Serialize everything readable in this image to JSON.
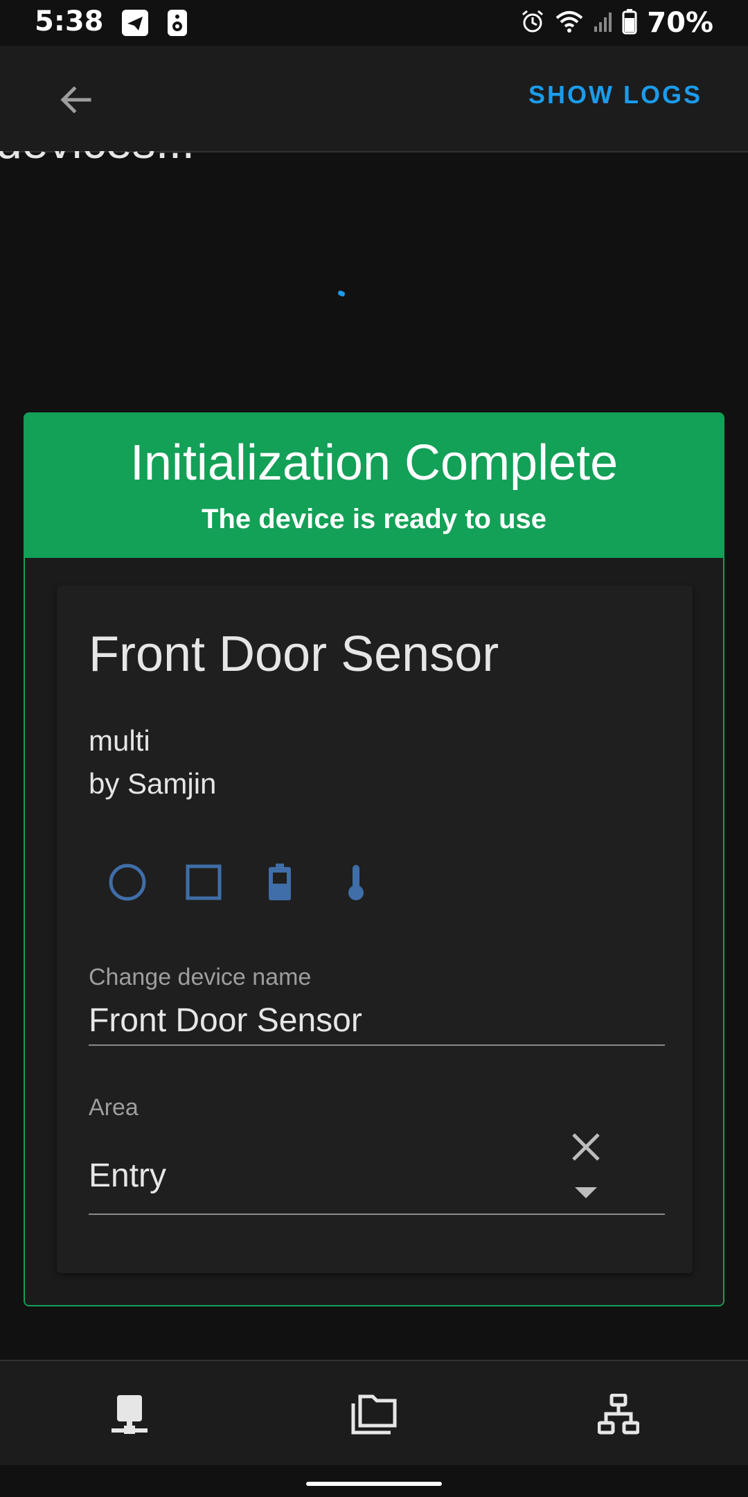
{
  "status_bar": {
    "time": "5:38",
    "battery_percent": "70%",
    "icons": [
      "telegram-icon",
      "speaker-icon",
      "alarm-icon",
      "wifi-icon",
      "cell-signal-icon",
      "battery-icon"
    ]
  },
  "app_bar": {
    "back_icon": "arrow-left-icon",
    "show_logs_label": "SHOW LOGS"
  },
  "background": {
    "heading_partial": "devices..."
  },
  "dialog": {
    "title": "Initialization Complete",
    "subtitle": "The device is ready to use",
    "device": {
      "name": "Front Door Sensor",
      "model": "multi",
      "manufacturer": "by Samjin",
      "entity_icons": [
        "circle-icon",
        "square-icon",
        "battery-icon",
        "thermometer-icon"
      ]
    },
    "name_field": {
      "label": "Change device name",
      "value": "Front Door Sensor"
    },
    "area_field": {
      "label": "Area",
      "value": "Entry"
    }
  },
  "bottom_nav": {
    "items": [
      "devices-icon",
      "folders-icon",
      "network-icon"
    ]
  },
  "colors": {
    "accent": "#1a9cee",
    "success": "#13a057",
    "icon_blue": "#3f6ea8"
  }
}
